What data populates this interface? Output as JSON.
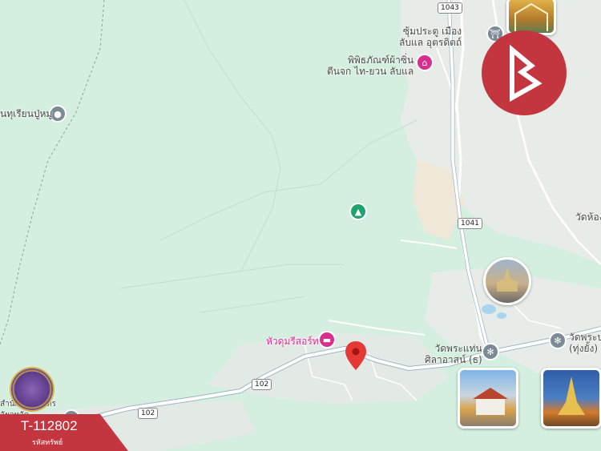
{
  "labels": {
    "dam_resort": "หัวดุมรีสอร์ท",
    "wat_phra_taen": "วัดพระแท่น\nศิลาอาสน์ (ธ)",
    "wat_phra_right": "วัดพระบ\n(ทุ่งยั้ง)",
    "museum": "พิพิธภัณฑ์ผ้าซิ่น\nตีนจก ไท-ยวน ลับแล",
    "city_gate": "ซุ้มประตู เมือง\nลับแล อุตรดิตถ์",
    "school_left": "นทุเรียนปู่หมู",
    "wat_hong": "วัดห้อง",
    "bottom_left_text": "สำนักงานเกษตร\nอัยวหวัด"
  },
  "roads": {
    "road_1043": "1043",
    "road_1041": "1041",
    "road_102_a": "102",
    "road_102_b": "102"
  },
  "badge": {
    "code": "T-112802",
    "caption": "รหัสทรัพย์"
  },
  "colors": {
    "map_green": "#d4efe0",
    "urban": "#e8ece8",
    "road": "#ffffff",
    "brand_red": "#c3363f",
    "pin_red": "#e53935",
    "poi_pink": "#d62f8d"
  },
  "icons": {
    "brand_logo": "brand-b-logo",
    "pin": "location-pin-icon",
    "hotel": "hotel-icon",
    "museum": "museum-icon",
    "gate": "landmark-icon",
    "temple": "temple-icon",
    "park": "park-icon",
    "school": "pin-icon",
    "seal": "government-seal"
  }
}
